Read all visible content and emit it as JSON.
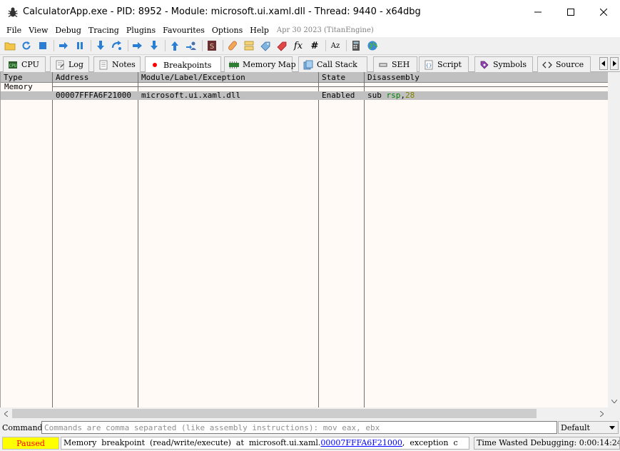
{
  "window": {
    "title": "CalculatorApp.exe - PID: 8952 - Module: microsoft.ui.xaml.dll - Thread: 9440 - x64dbg",
    "controls": [
      "minimize",
      "maximize",
      "close"
    ]
  },
  "menu": {
    "items": [
      "File",
      "View",
      "Debug",
      "Tracing",
      "Plugins",
      "Favourites",
      "Options",
      "Help"
    ],
    "date": "Apr 30 2023 (TitanEngine)"
  },
  "toolbar": {
    "icons": [
      "open-icon",
      "restart-icon",
      "stop-icon",
      "run-icon",
      "pause-icon",
      "step-into-icon",
      "step-over-icon",
      "trace-into-icon",
      "trace-over-icon",
      "execute-till-return-icon",
      "run-to-user-code-icon",
      "script-icon",
      "patch-icon",
      "comment-icon",
      "label-icon",
      "bookmark-icon",
      "function-icon",
      "variables-icon",
      "strings-icon",
      "calculator-icon",
      "web-icon"
    ],
    "function_label": "fx",
    "hash_label": "#",
    "az_label": "Az"
  },
  "tabs": [
    {
      "label": "CPU",
      "icon": "cpu-icon"
    },
    {
      "label": "Log",
      "icon": "log-icon"
    },
    {
      "label": "Notes",
      "icon": "notes-icon"
    },
    {
      "label": "Breakpoints",
      "icon": "breakpoint-dot-icon",
      "active": true
    },
    {
      "label": "Memory Map",
      "icon": "memory-map-icon"
    },
    {
      "label": "Call Stack",
      "icon": "call-stack-icon"
    },
    {
      "label": "SEH",
      "icon": "seh-icon"
    },
    {
      "label": "Script",
      "icon": "script-tab-icon"
    },
    {
      "label": "Symbols",
      "icon": "symbols-icon"
    },
    {
      "label": "Source",
      "icon": "source-icon"
    }
  ],
  "breakpoints": {
    "columns": [
      "Type",
      "Address",
      "Module/Label/Exception",
      "State",
      "Disassembly"
    ],
    "group_label": "Memory",
    "rows": [
      {
        "type": "",
        "address": "00007FFFA6F21000",
        "module": "microsoft.ui.xaml.dll",
        "state": "Enabled",
        "disasm_mnemonic": "sub",
        "disasm_reg": "rsp",
        "disasm_sep": ",",
        "disasm_imm": "28"
      }
    ]
  },
  "command": {
    "label": "Command:",
    "placeholder": "Commands are comma separated (like assembly instructions): mov eax, ebx",
    "value": "",
    "mode": "Default"
  },
  "status": {
    "state": "Paused",
    "message_prefix": "Memory  breakpoint  (read/write/execute)  at  microsoft.ui.xaml.",
    "message_link": "00007FFFA6F21000",
    "message_suffix": ",  exception  c",
    "time": "Time Wasted Debugging: 0:00:14:24"
  },
  "colors": {
    "table_background": "#fffaf5",
    "header_background": "#c0c0c0",
    "selected_row": "#c0c0c0",
    "register": "#008000",
    "immediate": "#808000",
    "paused_background": "#ffff00",
    "paused_text": "#ff0000",
    "breakpoint_dot": "#ff0000"
  }
}
